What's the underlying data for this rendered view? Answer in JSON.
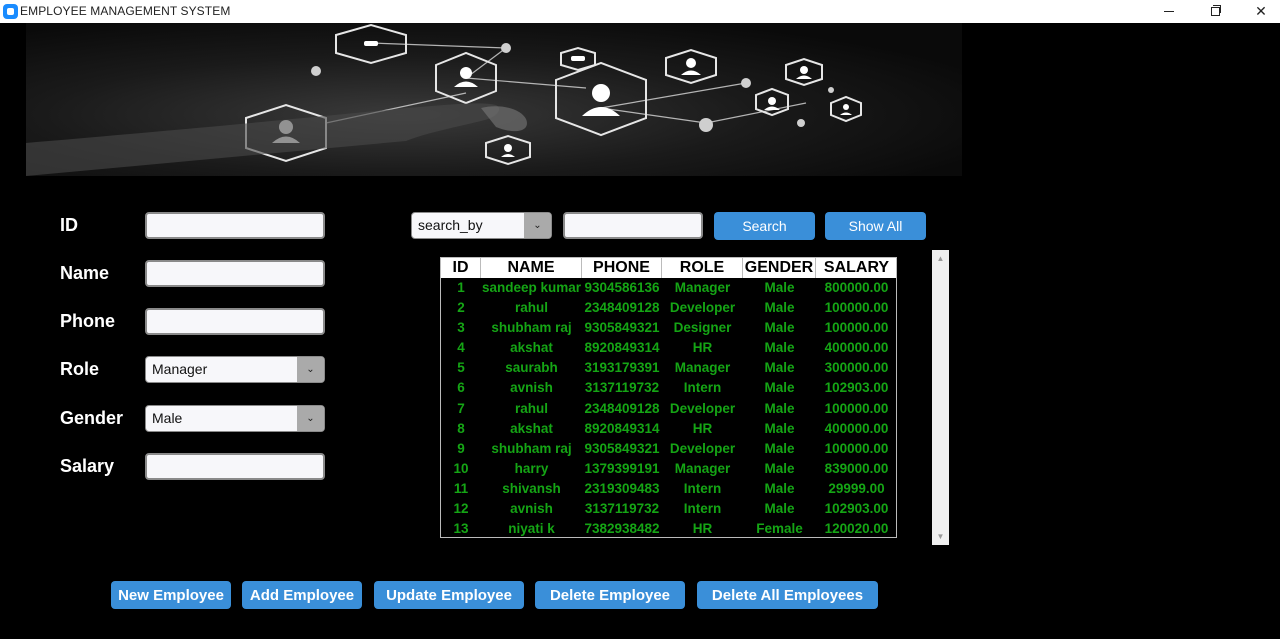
{
  "window": {
    "title": "EMPLOYEE MANAGEMENT SYSTEM"
  },
  "form": {
    "id_label": "ID",
    "name_label": "Name",
    "phone_label": "Phone",
    "role_label": "Role",
    "gender_label": "Gender",
    "salary_label": "Salary",
    "id_value": "",
    "name_value": "",
    "phone_value": "",
    "role_value": "Manager",
    "gender_value": "Male",
    "salary_value": ""
  },
  "search": {
    "search_by_value": "search_by",
    "query_value": "",
    "search_label": "Search",
    "show_all_label": "Show All"
  },
  "table": {
    "headers": [
      "ID",
      "NAME",
      "PHONE",
      "ROLE",
      "GENDER",
      "SALARY"
    ],
    "rows": [
      [
        "1",
        "sandeep kumar",
        "9304586136",
        "Manager",
        "Male",
        "800000.00"
      ],
      [
        "2",
        "rahul",
        "2348409128",
        "Developer",
        "Male",
        "100000.00"
      ],
      [
        "3",
        "shubham raj",
        "9305849321",
        "Designer",
        "Male",
        "100000.00"
      ],
      [
        "4",
        "akshat",
        "8920849314",
        "HR",
        "Male",
        "400000.00"
      ],
      [
        "5",
        "saurabh",
        "3193179391",
        "Manager",
        "Male",
        "300000.00"
      ],
      [
        "6",
        "avnish",
        "3137119732",
        "Intern",
        "Male",
        "102903.00"
      ],
      [
        "7",
        "rahul",
        "2348409128",
        "Developer",
        "Male",
        "100000.00"
      ],
      [
        "8",
        "akshat",
        "8920849314",
        "HR",
        "Male",
        "400000.00"
      ],
      [
        "9",
        "shubham raj",
        "9305849321",
        "Developer",
        "Male",
        "100000.00"
      ],
      [
        "10",
        "harry",
        "1379399191",
        "Manager",
        "Male",
        "839000.00"
      ],
      [
        "11",
        "shivansh",
        "2319309483",
        "Intern",
        "Male",
        "29999.00"
      ],
      [
        "12",
        "avnish",
        "3137119732",
        "Intern",
        "Male",
        "102903.00"
      ],
      [
        "13",
        "niyati k",
        "7382938482",
        "HR",
        "Female",
        "120020.00"
      ]
    ]
  },
  "actions": {
    "new_label": "New Employee",
    "add_label": "Add Employee",
    "update_label": "Update Employee",
    "delete_label": "Delete Employee",
    "delete_all_label": "Delete All Employees"
  },
  "colors": {
    "button": "#3a8fd9",
    "table_text": "#15a515",
    "background": "#000000"
  }
}
